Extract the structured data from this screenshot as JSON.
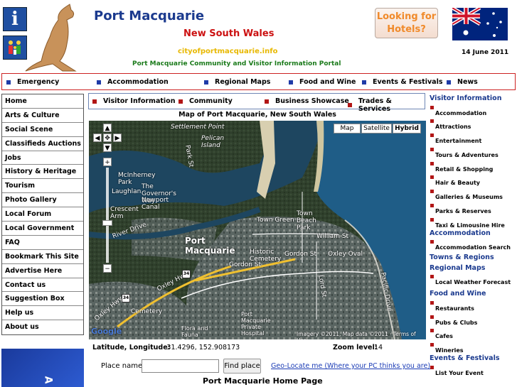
{
  "header": {
    "site_name": "Port Macquarie",
    "region": "New South Wales",
    "domain": "cityofportmacquarie.info",
    "portal_title": "Port Macquarie Community and Visitor Information Portal",
    "hotels_button": "Looking for Hotels?",
    "date": "14 June 2011"
  },
  "top_nav": [
    "Emergency",
    "Accommodation",
    "Regional Maps",
    "Food and Wine",
    "Events & Festivals",
    "News"
  ],
  "left_nav": [
    "Home",
    "Arts & Culture",
    "Social Scene",
    "Classifieds Auctions",
    "Jobs",
    "History & Heritage",
    "Tourism",
    "Photo Gallery",
    "Local Forum",
    "Local Government",
    "FAQ",
    "Bookmark This Site",
    "Advertise Here",
    "Contact us",
    "Suggestion Box",
    "Help us",
    "About us"
  ],
  "secondary_nav": [
    "Visitor Information",
    "Community",
    "Business Showcase",
    "Trades & Services"
  ],
  "map": {
    "title": "Map of Port Macquarie, New South Wales",
    "type_buttons": [
      "Map",
      "Satellite",
      "Hybrid"
    ],
    "selected_type": "Hybrid",
    "labels": {
      "settlement_point": "Settlement Point",
      "pelican_island": "Pelican Island",
      "mcinherney_park": "McInherney Park",
      "governors_way": "The Governor's Way",
      "newport_canal": "Newport Canal",
      "laughlan": "Laughlan",
      "crescent_arm": "Crescent Arm",
      "river_drive": "River Drive",
      "park_st": "Park St",
      "town_green": "Town Green",
      "town_beach_park": "Town Beach Park",
      "william_st": "William St",
      "port_macquarie": "Port Macquarie",
      "historic_cemetery": "Historic Cemetery",
      "gordon_st": "Gordon St",
      "gordon_st_2": "Gordon St",
      "oxley_oval": "Oxley Oval",
      "lord_st": "Lord St",
      "pacific_dr": "Pacific Drive",
      "oxley_hwy": "Oxley Hwy",
      "oxley_hwy_2": "Oxley Hwy",
      "cemetery": "Cemetery",
      "private_hospital": "Port Macquarie Private Hospital",
      "flora_reserve": "Flora and Fauna Reserve",
      "route_34a": "34",
      "route_34b": "34",
      "google": "Google",
      "copyright": "Imagery ©2011, Map data ©2011 · Terms of Use"
    }
  },
  "coords": {
    "latlng_label": "Latitude, Longitude:",
    "latlng_value": "-31.4296, 152.908173",
    "zoom_label": "Zoom level:",
    "zoom_value": "14"
  },
  "search": {
    "label": "Place name:",
    "value": "",
    "button": "Find place",
    "geolocate": "Geo-Locate me (Where your PC thinks you are)"
  },
  "home_heading": "Port Macquarie Home Page",
  "right_nav": [
    {
      "heading": "Visitor Information",
      "items": [
        "Accommodation",
        "Attractions",
        "Entertainment",
        "Tours & Adventures",
        "Retail & Shopping",
        "Hair & Beauty",
        "Galleries & Museums",
        "Parks & Reserves",
        "Taxi & Limousine Hire"
      ]
    },
    {
      "heading": "Accommodation",
      "items": [
        "Accommodation Search"
      ]
    },
    {
      "heading": "Towns & Regions",
      "items": []
    },
    {
      "heading": "Regional Maps",
      "items": [
        "Local Weather Forecast"
      ]
    },
    {
      "heading": "Food and Wine",
      "items": [
        "Restaurants",
        "Pubs & Clubs",
        "Cafes",
        "Wineries"
      ]
    },
    {
      "heading": "Events & Festivals",
      "items": [
        "List Your Event"
      ]
    }
  ],
  "ad_text": "A"
}
